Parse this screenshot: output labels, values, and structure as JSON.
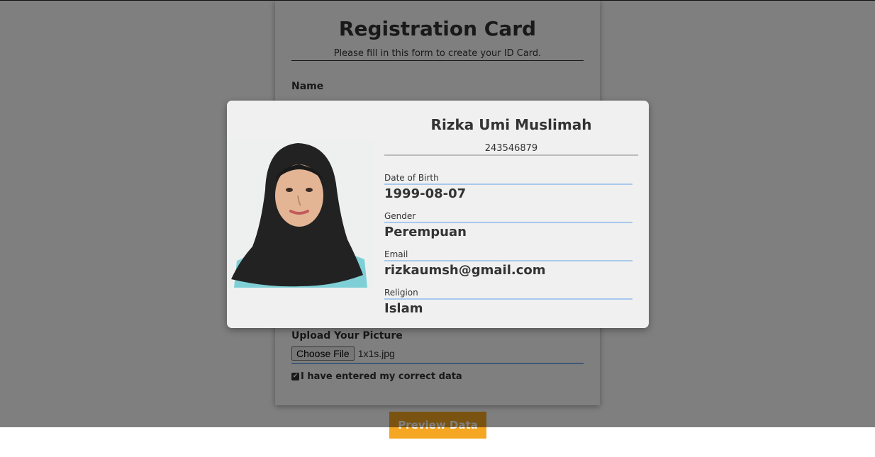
{
  "form": {
    "title": "Registration Card",
    "subtitle": "Please fill in this form to create your ID Card.",
    "name_label": "Name",
    "name_value": "Rizka Umi Muslimah",
    "upload_label": "Upload Your Picture",
    "file_button": "Choose File",
    "file_name": "1x1s.jpg",
    "confirm_label": "I have entered my correct data",
    "preview_button": "Preview Data"
  },
  "card": {
    "name": "Rizka Umi Muslimah",
    "id_number": "243546879",
    "details": [
      {
        "label": "Date of Birth",
        "value": "1999-08-07"
      },
      {
        "label": "Gender",
        "value": "Perempuan"
      },
      {
        "label": "Email",
        "value": "rizkaumsh@gmail.com"
      },
      {
        "label": "Religion",
        "value": "Islam"
      }
    ]
  },
  "colors": {
    "accent_underline": "#a9c9ec",
    "button": "#f5a623",
    "overlay": "#000000"
  }
}
